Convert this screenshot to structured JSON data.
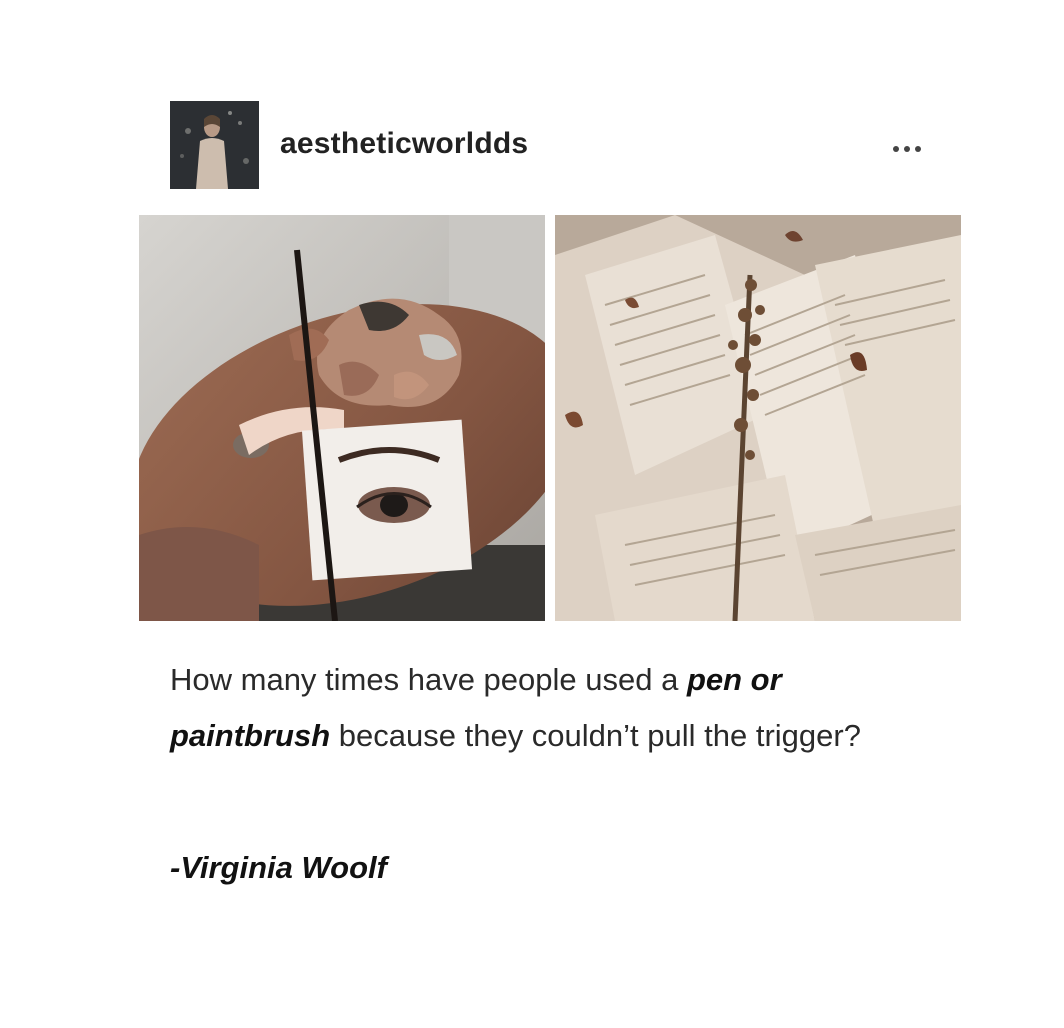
{
  "post": {
    "username": "aestheticworldds",
    "more_label": "•••",
    "icons": {
      "more": "more-horizontal-icon"
    },
    "caption": {
      "part1": "How many times have people used a ",
      "bold1": "pen or paintbrush",
      "part2": "  because they couldn’t pull the trigger?"
    },
    "attribution": "-Virginia Woolf"
  },
  "colors": {
    "background": "#ffffff",
    "text": "#2a2a2a",
    "palette_wood": "#8a5c45",
    "paper": "#e8ddd0"
  }
}
